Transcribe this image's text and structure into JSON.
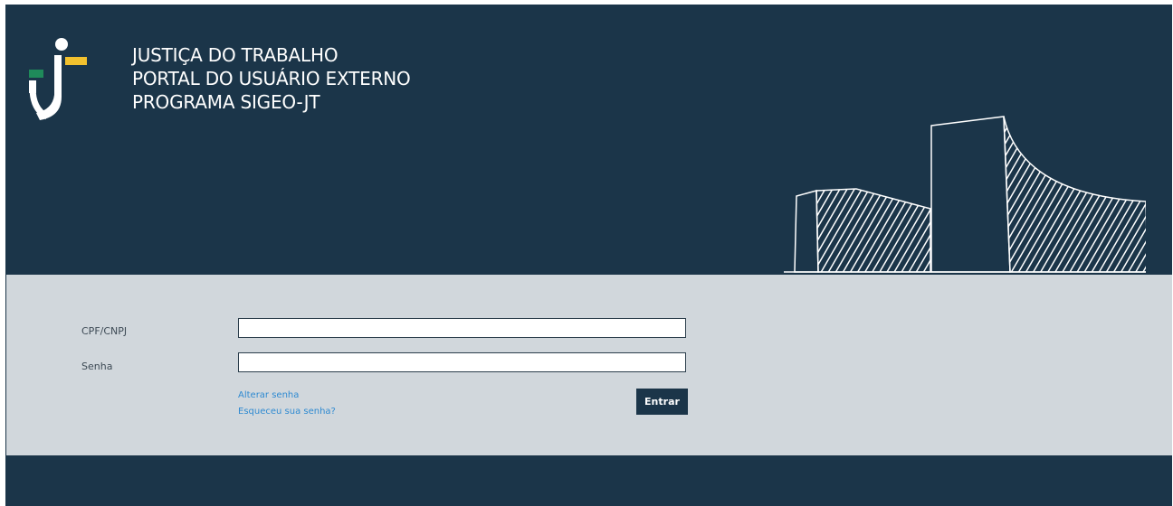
{
  "header": {
    "title_lines": [
      "JUSTIÇA DO TRABALHO",
      "PORTAL DO USUÁRIO EXTERNO",
      "PROGRAMA SIGEO-JT"
    ]
  },
  "form": {
    "cpf_label": "CPF/CNPJ",
    "cpf_value": "",
    "senha_label": "Senha",
    "senha_value": "",
    "alterar_link": "Alterar senha",
    "esqueceu_link": "Esqueceu sua senha?",
    "submit_label": "Entrar"
  },
  "colors": {
    "primary": "#1b3549",
    "form_bg": "#d1d7dc",
    "link": "#2f8ad1",
    "logo_green": "#1f8a5a",
    "logo_yellow": "#f2c12e"
  },
  "icons": {
    "logo": "jt-logo-icon",
    "illustration": "building-sketch-icon"
  }
}
